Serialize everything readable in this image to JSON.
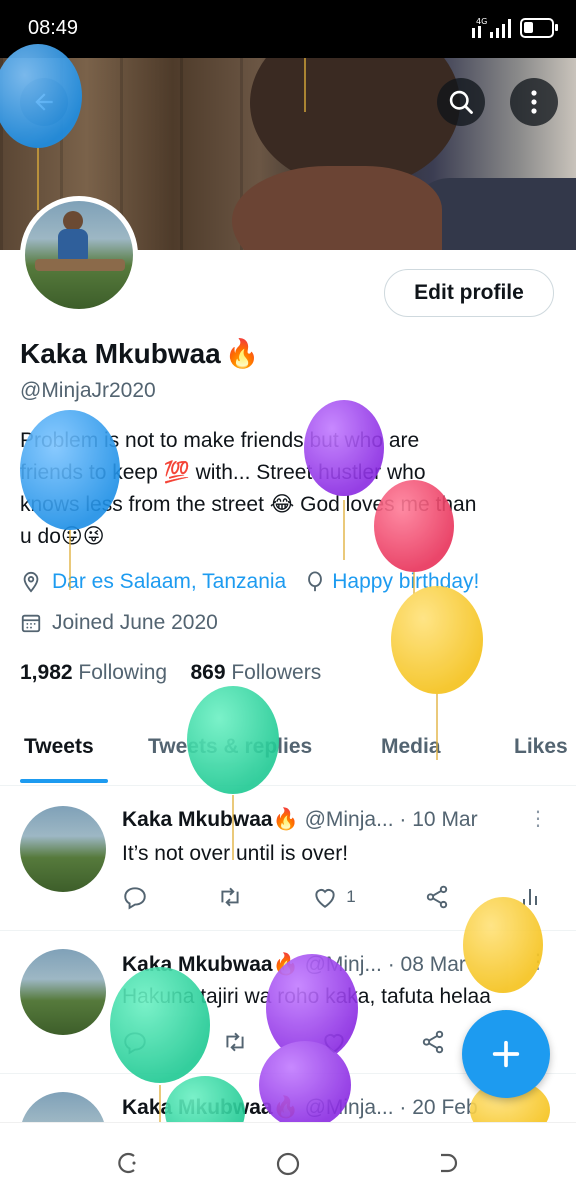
{
  "status_bar": {
    "time": "08:49",
    "network": "4G"
  },
  "header": {
    "back_icon": "arrow-left-icon",
    "search_icon": "search-icon",
    "more_icon": "more-vertical-icon"
  },
  "profile": {
    "edit_button": "Edit profile",
    "name": "Kaka Mkubwaa",
    "name_emoji": "🔥",
    "handle": "@MinjaJr2020",
    "bio_line1": "Problem is not to make friends but who are",
    "bio_line2": "friends to keep 💯 with... Street hustler who",
    "bio_line3": "knows less from the street 😂 God loves me than",
    "bio_line4": "u do😛😜",
    "location": "Dar es Salaam, Tanzania",
    "birthday": "Happy birthday!",
    "joined": "Joined June 2020",
    "following_count": "1,982",
    "following_label": "Following",
    "followers_count": "869",
    "followers_label": "Followers"
  },
  "tabs": [
    {
      "label": "Tweets",
      "active": true
    },
    {
      "label": "Tweets & replies"
    },
    {
      "label": "Media"
    },
    {
      "label": "Likes"
    }
  ],
  "tweets": [
    {
      "name": "Kaka Mkubwaa🔥",
      "handle": "@Minja...",
      "date": "· 10 Mar",
      "text": "It’s not over until is over!",
      "likes": "1"
    },
    {
      "name": "Kaka Mkubwaa🔥",
      "handle": "@Minj...",
      "date": "· 08 Mar",
      "text": "Hakuna tajiri wa roho kaka, tafuta helaa",
      "likes": ""
    },
    {
      "name": "Kaka Mkubwaa🔥",
      "handle": "@Minja...",
      "date": "· 20 Feb",
      "text": "",
      "likes": ""
    }
  ],
  "fab": {
    "icon": "plus-icon"
  },
  "nav": {
    "recents_icon": "recents-icon",
    "home_icon": "home-circle-icon",
    "back_icon": "back-icon"
  },
  "colors": {
    "accent": "#1d9bf0",
    "text": "#0f1419",
    "secondary": "#536471"
  }
}
